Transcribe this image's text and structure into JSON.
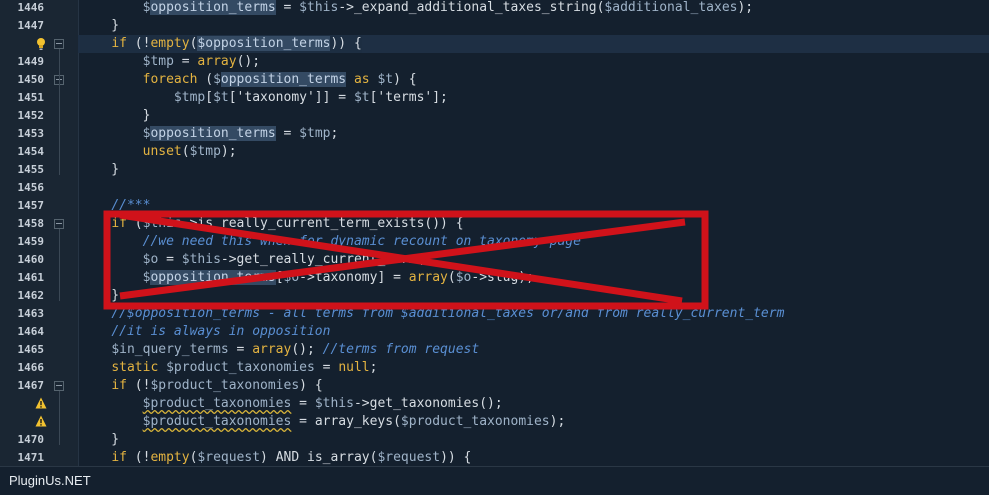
{
  "lines": [
    {
      "num": "1446",
      "code": [
        {
          "t": "        "
        },
        {
          "t": "$",
          "c": "var"
        },
        {
          "t": "opposition_terms",
          "c": "hl"
        },
        {
          "t": " = "
        },
        {
          "t": "$this",
          "c": "var"
        },
        {
          "t": "->_expand_additional_taxes_string("
        },
        {
          "t": "$additional_taxes",
          "c": "var"
        },
        {
          "t": ");"
        }
      ]
    },
    {
      "num": "1447",
      "code": [
        {
          "t": "    }"
        }
      ]
    },
    {
      "num": "",
      "marker": "bulb",
      "current": true,
      "code": [
        {
          "t": "    "
        },
        {
          "t": "if",
          "c": "kw"
        },
        {
          "t": " (!"
        },
        {
          "t": "empty",
          "c": "kw"
        },
        {
          "t": "("
        },
        {
          "t": "$opposition_terms",
          "c": "hl"
        },
        {
          "t": ")) {"
        }
      ]
    },
    {
      "num": "1449",
      "code": [
        {
          "t": "        "
        },
        {
          "t": "$tmp",
          "c": "var"
        },
        {
          "t": " = "
        },
        {
          "t": "array",
          "c": "kw"
        },
        {
          "t": "();"
        }
      ]
    },
    {
      "num": "1450",
      "code": [
        {
          "t": "        "
        },
        {
          "t": "foreach",
          "c": "kw"
        },
        {
          "t": " ("
        },
        {
          "t": "$",
          "c": "var"
        },
        {
          "t": "opposition_terms",
          "c": "hl"
        },
        {
          "t": " "
        },
        {
          "t": "as",
          "c": "kw"
        },
        {
          "t": " "
        },
        {
          "t": "$t",
          "c": "var"
        },
        {
          "t": ") {"
        }
      ]
    },
    {
      "num": "1451",
      "code": [
        {
          "t": "            "
        },
        {
          "t": "$tmp",
          "c": "var"
        },
        {
          "t": "["
        },
        {
          "t": "$t",
          "c": "var"
        },
        {
          "t": "['taxonomy']] = "
        },
        {
          "t": "$t",
          "c": "var"
        },
        {
          "t": "['terms'];"
        }
      ]
    },
    {
      "num": "1452",
      "code": [
        {
          "t": "        }"
        }
      ]
    },
    {
      "num": "1453",
      "code": [
        {
          "t": "        "
        },
        {
          "t": "$",
          "c": "var"
        },
        {
          "t": "opposition_terms",
          "c": "hl"
        },
        {
          "t": " = "
        },
        {
          "t": "$tmp",
          "c": "var"
        },
        {
          "t": ";"
        }
      ]
    },
    {
      "num": "1454",
      "code": [
        {
          "t": "        "
        },
        {
          "t": "unset",
          "c": "kw"
        },
        {
          "t": "("
        },
        {
          "t": "$tmp",
          "c": "var"
        },
        {
          "t": ");"
        }
      ]
    },
    {
      "num": "1455",
      "code": [
        {
          "t": "    }"
        }
      ]
    },
    {
      "num": "1456",
      "code": [
        {
          "t": ""
        }
      ]
    },
    {
      "num": "1457",
      "code": [
        {
          "t": "    "
        },
        {
          "t": "//***",
          "c": "cm"
        }
      ]
    },
    {
      "num": "1458",
      "code": [
        {
          "t": "    "
        },
        {
          "t": "if",
          "c": "kw"
        },
        {
          "t": " ("
        },
        {
          "t": "$this",
          "c": "var"
        },
        {
          "t": "->is_really_current_term_exists()) {"
        }
      ]
    },
    {
      "num": "1459",
      "code": [
        {
          "t": "        "
        },
        {
          "t": "//we need this when for dynamic recount on taxonomy page",
          "c": "cm"
        }
      ]
    },
    {
      "num": "1460",
      "code": [
        {
          "t": "        "
        },
        {
          "t": "$o",
          "c": "var"
        },
        {
          "t": " = "
        },
        {
          "t": "$this",
          "c": "var"
        },
        {
          "t": "->get_really_current_term();"
        }
      ]
    },
    {
      "num": "1461",
      "code": [
        {
          "t": "        "
        },
        {
          "t": "$",
          "c": "var"
        },
        {
          "t": "opposition_terms",
          "c": "hl"
        },
        {
          "t": "["
        },
        {
          "t": "$o",
          "c": "var"
        },
        {
          "t": "->taxonomy] = "
        },
        {
          "t": "array",
          "c": "kw"
        },
        {
          "t": "("
        },
        {
          "t": "$o",
          "c": "var"
        },
        {
          "t": "->slug);"
        }
      ]
    },
    {
      "num": "1462",
      "code": [
        {
          "t": "    }"
        }
      ]
    },
    {
      "num": "1463",
      "code": [
        {
          "t": "    "
        },
        {
          "t": "//$opposition_terms - all terms from $additional_taxes or/and from really_current_term",
          "c": "cm"
        }
      ]
    },
    {
      "num": "1464",
      "code": [
        {
          "t": "    "
        },
        {
          "t": "//it is always in opposition",
          "c": "cm"
        }
      ]
    },
    {
      "num": "1465",
      "code": [
        {
          "t": "    "
        },
        {
          "t": "$in_query_terms",
          "c": "var"
        },
        {
          "t": " = "
        },
        {
          "t": "array",
          "c": "kw"
        },
        {
          "t": "(); "
        },
        {
          "t": "//terms from request",
          "c": "cm"
        }
      ]
    },
    {
      "num": "1466",
      "code": [
        {
          "t": "    "
        },
        {
          "t": "static",
          "c": "kw"
        },
        {
          "t": " "
        },
        {
          "t": "$product_taxonomies",
          "c": "var"
        },
        {
          "t": " = "
        },
        {
          "t": "null",
          "c": "kw"
        },
        {
          "t": ";"
        }
      ]
    },
    {
      "num": "1467",
      "code": [
        {
          "t": "    "
        },
        {
          "t": "if",
          "c": "kw"
        },
        {
          "t": " (!"
        },
        {
          "t": "$product_taxonomies",
          "c": "var"
        },
        {
          "t": ") {"
        }
      ]
    },
    {
      "num": "",
      "marker": "warn",
      "code": [
        {
          "t": "        "
        },
        {
          "t": "$product_taxonomies",
          "c": "var warn"
        },
        {
          "t": " = "
        },
        {
          "t": "$this",
          "c": "var"
        },
        {
          "t": "->get_taxonomies();"
        }
      ]
    },
    {
      "num": "",
      "marker": "warn",
      "code": [
        {
          "t": "        "
        },
        {
          "t": "$product_taxonomies",
          "c": "var warn"
        },
        {
          "t": " = array_keys("
        },
        {
          "t": "$product_taxonomies",
          "c": "var"
        },
        {
          "t": ");"
        }
      ]
    },
    {
      "num": "1470",
      "code": [
        {
          "t": "    }"
        }
      ]
    },
    {
      "num": "1471",
      "code": [
        {
          "t": "    "
        },
        {
          "t": "if",
          "c": "kw"
        },
        {
          "t": " (!"
        },
        {
          "t": "empty",
          "c": "kw"
        },
        {
          "t": "("
        },
        {
          "t": "$request",
          "c": "var"
        },
        {
          "t": ") AND is_array("
        },
        {
          "t": "$request",
          "c": "var"
        },
        {
          "t": ")) {"
        }
      ]
    }
  ],
  "footer": {
    "watermark": "PluginUs.NET"
  },
  "colors": {
    "background": "#14202e",
    "gutter": "#1a2633",
    "cross": "#d0121a",
    "keyword": "#e3b341",
    "comment": "#5a8fd3"
  },
  "icons": {
    "bulb": "lightbulb-icon",
    "warn": "warning-icon"
  }
}
